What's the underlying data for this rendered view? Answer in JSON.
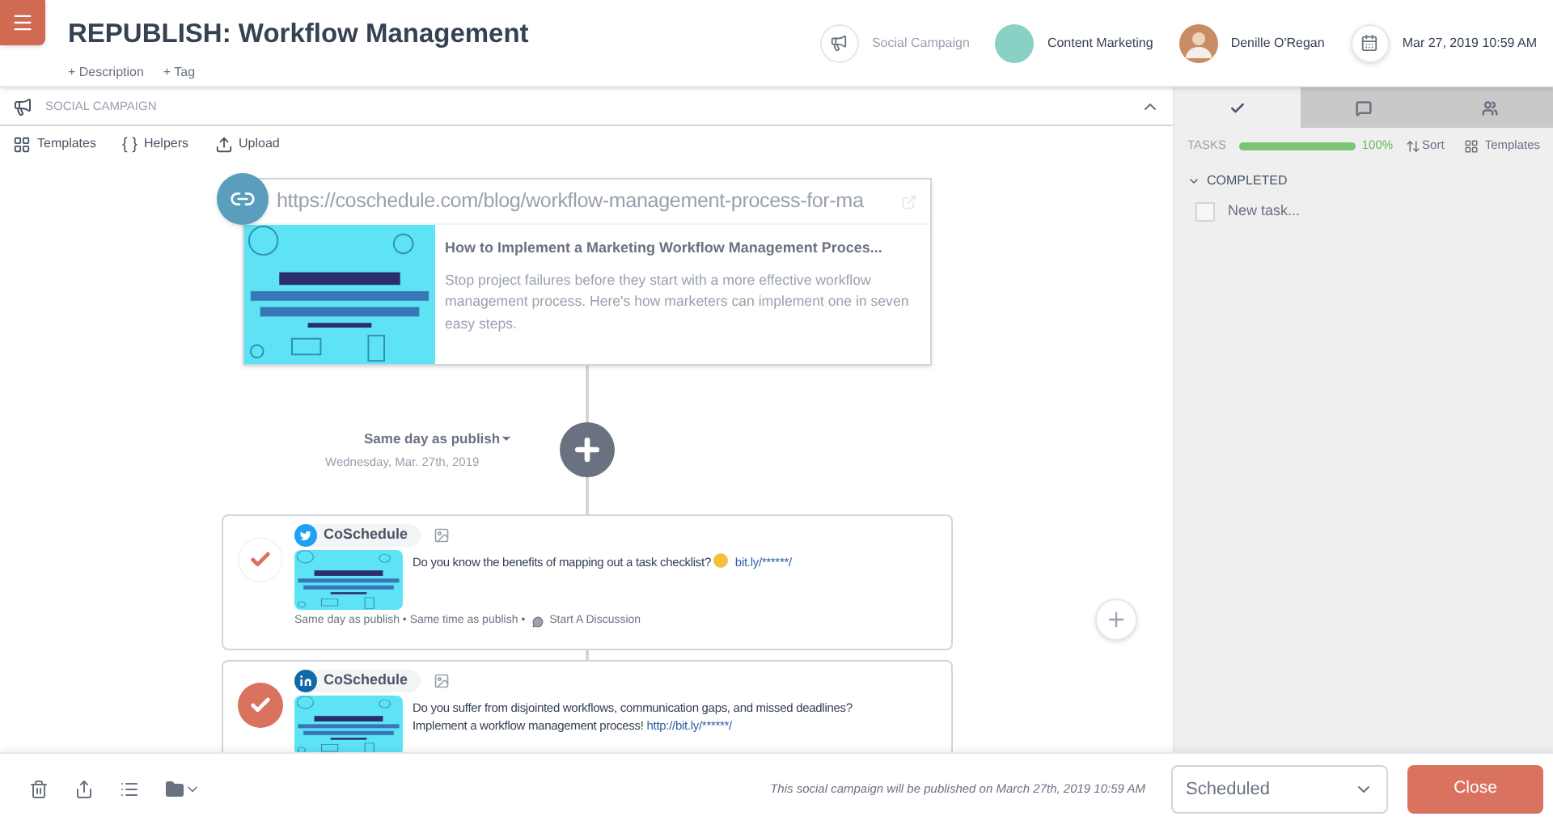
{
  "header": {
    "title": "REPUBLISH: Workflow Management",
    "actions": [
      "+ Description",
      "+ Tag"
    ],
    "meta": [
      {
        "kind": "type",
        "label": "Social Campaign"
      },
      {
        "kind": "color",
        "label": "Content Marketing",
        "color": "#88d1c4"
      },
      {
        "kind": "person",
        "label": "Denille O'Regan"
      },
      {
        "kind": "date",
        "label": "Mar 27, 2019 10:59 AM"
      }
    ]
  },
  "section": {
    "title": "SOCIAL CAMPAIGN",
    "expanded": true
  },
  "toolbar": [
    {
      "kind": "templates",
      "label": "Templates"
    },
    {
      "kind": "helpers",
      "icon": "{ }",
      "label": "Helpers"
    },
    {
      "kind": "upload",
      "label": "Upload"
    }
  ],
  "link_card": {
    "url": "https://coschedule.com/blog/workflow-management-process-for-ma",
    "title": "How to Implement a Marketing Workflow Management Proces...",
    "description": "Stop project failures before they start with a more effective workflow management process. Here's how marketers can implement one in seven easy steps."
  },
  "schedule": {
    "label": "Same day as publish",
    "date": "Wednesday, Mar. 27th, 2019"
  },
  "posts": [
    {
      "kind": "twitter",
      "color": "#ffffff",
      "account": "CoSchedule",
      "lines": [
        "Do you know the benefits of mapping out a task checklist?"
      ],
      "emoji": true,
      "link": "bit.ly/******/",
      "meta": "Same day as publish • Same time as publish •",
      "discussion": "Start A Discussion"
    },
    {
      "kind": "linkedin",
      "color": "#d9725f",
      "account": "CoSchedule",
      "lines": [
        "Do you suffer from disjointed workflows, communication gaps, and missed deadlines?",
        "Implement a workflow management process!"
      ],
      "emoji": false,
      "link": "http://bit.ly/******/"
    }
  ],
  "side_panel": {
    "tabs": [
      {
        "kind": "tasks",
        "selected": true
      },
      {
        "kind": "comments",
        "selected": false
      },
      {
        "kind": "people",
        "selected": false
      }
    ],
    "tasks_label": "TASKS",
    "level": 1,
    "percent": "100%",
    "sort": "Sort",
    "templates": "Templates",
    "group": {
      "label": "COMPLETED",
      "expanded": true
    },
    "new_task": {
      "placeholder": "New task...",
      "checked": false
    }
  },
  "footer": {
    "note": "This social campaign will be published on March 27th, 2019 10:59 AM",
    "status": "Scheduled",
    "close": "Close"
  }
}
